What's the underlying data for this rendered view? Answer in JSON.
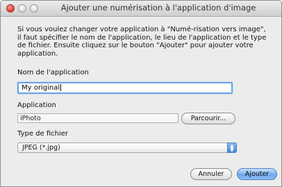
{
  "window": {
    "title": "Ajouter une numérisation à l'application d'image"
  },
  "description": "Si vous voulez changer votre application à \"Numé-risation vers image\", il faut spécifier le nom de l'application, le lieu de l'application et le type de fichier. Ensuite cliquez sur le bouton \"Ajouter\" pour ajouter votre application.",
  "app_name": {
    "label": "Nom de l'application",
    "value": "My original"
  },
  "application": {
    "label": "Application",
    "value": "iPhoto",
    "browse_label": "Parcourir..."
  },
  "file_type": {
    "label": "Type de fichier",
    "selected": "JPEG (*.jpg)"
  },
  "buttons": {
    "cancel": "Annuler",
    "add": "Ajouter"
  },
  "icons": {
    "close": "close-traffic-light",
    "minimize": "minimize-traffic-light",
    "zoom": "zoom-traffic-light",
    "select_arrows": "up-down-arrows-icon"
  },
  "colors": {
    "focus_ring": "#6ba2e4",
    "default_button": "#6fa8ee"
  }
}
